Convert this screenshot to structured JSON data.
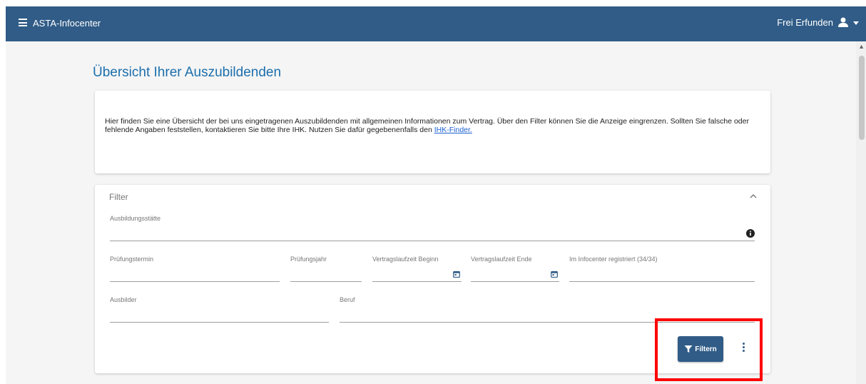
{
  "header": {
    "app_title": "ASTA-Infocenter",
    "user_name": "Frei Erfunden",
    "bg_color": "#305c87"
  },
  "page": {
    "title": "Übersicht Ihrer Auszubildenden"
  },
  "info": {
    "text": "Hier finden Sie eine Übersicht der bei uns eingetragenen Auszubildenden mit allgemeinen Informationen zum Vertrag. Über den Filter können Sie die Anzeige eingrenzen. Sollten Sie falsche oder fehlende Angaben feststellen, kontaktieren Sie bitte Ihre IHK. Nutzen Sie dafür gegebenenfalls den ",
    "link_label": "IHK-Finder."
  },
  "filter": {
    "title": "Filter",
    "fields": {
      "ausbildungsstaette": "Ausbildungsstätte",
      "pruefungstermin": "Prüfungstermin",
      "pruefungsjahr": "Prüfungsjahr",
      "vertrag_beginn": "Vertragslaufzeit Beginn",
      "vertrag_ende": "Vertragslaufzeit Ende",
      "registriert": "Im Infocenter registriert (34/34)",
      "ausbilder": "Ausbilder",
      "beruf": "Beruf"
    },
    "button_label": "Filtern"
  },
  "icons": [
    "menu-icon",
    "user-icon",
    "chevron-up-icon",
    "info-icon",
    "calendar-icon",
    "filter-icon",
    "more-vert-icon"
  ],
  "highlight_color": "#ff0000"
}
